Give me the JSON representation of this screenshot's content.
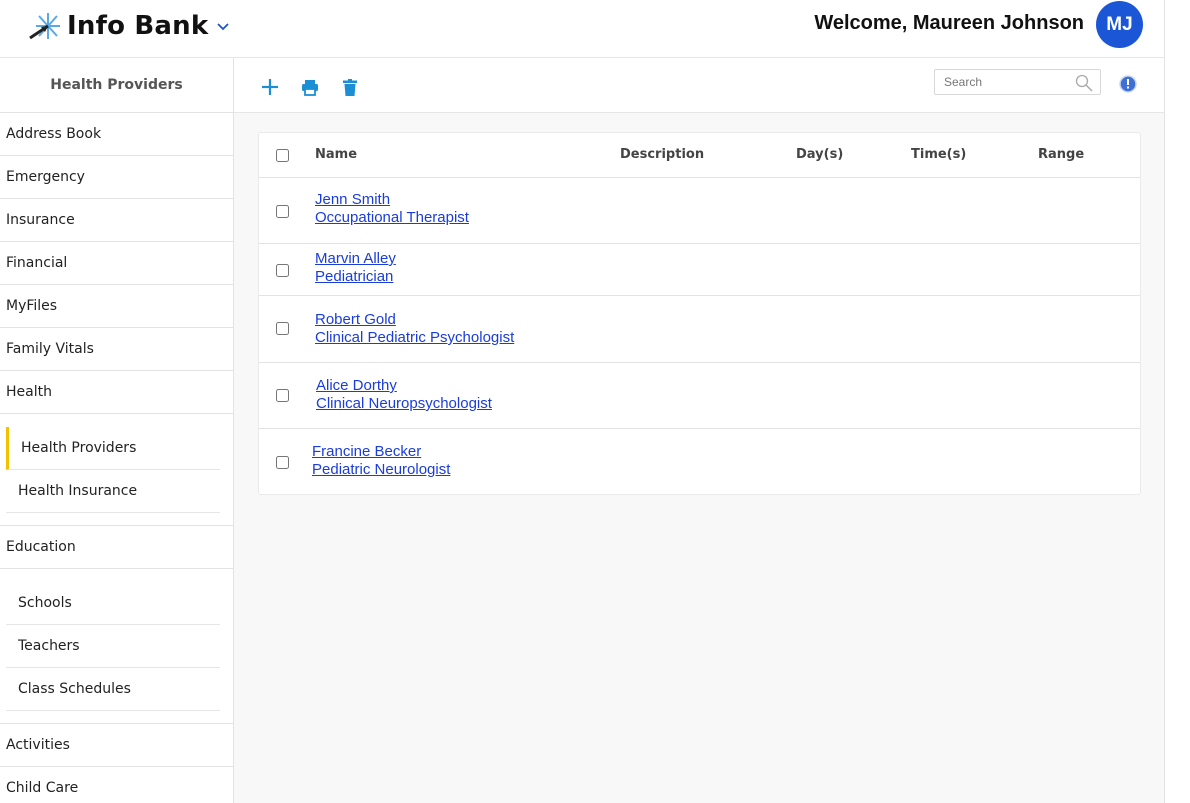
{
  "header": {
    "app_title": "Info Bank",
    "welcome_text": "Welcome, Maureen Johnson",
    "avatar_initials": "MJ",
    "avatar_color": "#1a56d6"
  },
  "sidebar": {
    "title": "Health Providers",
    "items": [
      {
        "label": "Address Book"
      },
      {
        "label": "Emergency"
      },
      {
        "label": "Insurance"
      },
      {
        "label": "Financial"
      },
      {
        "label": "MyFiles"
      },
      {
        "label": "Family Vitals"
      },
      {
        "label": "Health"
      }
    ],
    "health_sub": [
      {
        "label": "Health Providers",
        "active": true
      },
      {
        "label": "Health Insurance"
      }
    ],
    "education": {
      "label": "Education"
    },
    "education_sub": [
      {
        "label": "Schools"
      },
      {
        "label": "Teachers"
      },
      {
        "label": "Class Schedules"
      }
    ],
    "bottom_items": [
      {
        "label": "Activities"
      },
      {
        "label": "Child Care"
      }
    ],
    "active_accent": "#f2c200"
  },
  "toolbar": {
    "add_icon": "plus-icon",
    "print_icon": "printer-icon",
    "delete_icon": "trash-icon",
    "search_placeholder": "Search",
    "accent_color": "#1a8fd6"
  },
  "table": {
    "columns": {
      "name": "Name",
      "description": "Description",
      "days": "Day(s)",
      "times": "Time(s)",
      "range": "Range"
    },
    "rows": [
      {
        "name": "Jenn Smith",
        "role": "Occupational Therapist"
      },
      {
        "name": "Marvin Alley",
        "role": "Pediatrician"
      },
      {
        "name": "Robert Gold",
        "role": "Clinical Pediatric Psychologist"
      },
      {
        "name": "Alice Dorthy",
        "role": "Clinical Neuropsychologist"
      },
      {
        "name": "Francine Becker",
        "role": "Pediatric Neurologist"
      }
    ],
    "link_color": "#1a3cdc"
  }
}
